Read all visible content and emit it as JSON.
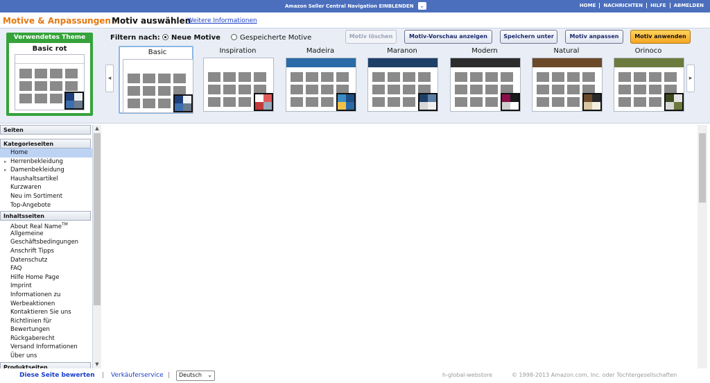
{
  "topbar": {
    "nav_toggle": "Amazon Seller Central Navigation EINBLENDEN",
    "links": [
      "HOME",
      "NACHRICHTEN",
      "HILFE",
      "ABMELDEN"
    ]
  },
  "header": {
    "section": "Motive & Anpassungen",
    "separator": ":",
    "title": "Motiv auswählen",
    "more_link": "Weitere Informationen"
  },
  "current_theme": {
    "caption": "Verwendetes Theme",
    "name": "Basic rot",
    "swatch": [
      "#1f3f7a",
      "#eef2f6",
      "#3c6fb0",
      "#6b7a8c"
    ]
  },
  "filter": {
    "label": "Filtern nach:",
    "options": [
      "Neue Motive",
      "Gespeicherte Motive"
    ],
    "selected": "Neue Motive"
  },
  "buttons": {
    "delete": "Motiv löschen",
    "preview": "Motiv-Vorschau anzeigen",
    "save_as": "Speichern unter",
    "customize": "Motiv anpassen",
    "apply": "Motiv anwenden"
  },
  "themes": [
    {
      "name": "Basic",
      "selected": true,
      "header": "#ffffff",
      "swatch": [
        "#1f3f7a",
        "#eef2f6",
        "#3c6fb0",
        "#6b7a8c"
      ]
    },
    {
      "name": "Inspiration",
      "selected": false,
      "header": "#ffffff",
      "swatch": [
        "#ffffff",
        "#e05a5a",
        "#c23b3b",
        "#9aa9b8"
      ]
    },
    {
      "name": "Madeira",
      "selected": false,
      "header": "#2a6aa6",
      "swatch": [
        "#3b8cc4",
        "#1c4f85",
        "#f0c24b",
        "#2a6aa6"
      ]
    },
    {
      "name": "Maranon",
      "selected": false,
      "header": "#1e3f68",
      "swatch": [
        "#1e3f68",
        "#5c7fa8",
        "#d8d8d8",
        "#f0f0f0"
      ]
    },
    {
      "name": "Modern",
      "selected": false,
      "header": "#2c2c2c",
      "swatch": [
        "#8a0f4a",
        "#1a1a1a",
        "#d0d0d0",
        "#ffffff"
      ]
    },
    {
      "name": "Natural",
      "selected": false,
      "header": "#6b4a2a",
      "swatch": [
        "#6b4a2a",
        "#2a2a2a",
        "#d9c6a3",
        "#f5efe2"
      ]
    },
    {
      "name": "Orinoco",
      "selected": false,
      "header": "#6d7a3d",
      "swatch": [
        "#3b4a1e",
        "#e6e6e6",
        "#d8d8d8",
        "#6d7a3d"
      ]
    }
  ],
  "sidebar": {
    "pages_header": "Seiten",
    "category_header": "Kategorieseiten",
    "category_items": [
      "Home",
      "Herrenbekleidung",
      "Damenbekleidung",
      "Haushaltsartikel",
      "Kurzwaren",
      "Neu im Sortiment",
      "Top-Angebote"
    ],
    "current_item": "Home",
    "content_header": "Inhaltsseiten",
    "content_items": [
      "About Real Name",
      "Allgemeine",
      "Geschäftsbedingungen",
      "Anschrift Tipps",
      "Datenschutz",
      "FAQ",
      "Hilfe Home Page",
      "Imprint",
      "Informationen zu",
      "Werbeaktionen",
      "Kontaktieren Sie uns",
      "Richtlinien für",
      "Bewertungen",
      "Rückgaberecht",
      "Versand Informationen",
      "Über uns"
    ],
    "trademark": "TM",
    "product_header": "Produktseiten"
  },
  "footer": {
    "rate": "Diese Seite bewerten",
    "seller_service": "Verkäuferservice",
    "language": "Deutsch",
    "store": "h-global-webstore",
    "copyright": "© 1998-2013 Amazon.com, Inc. oder Tochtergesellschaften"
  }
}
